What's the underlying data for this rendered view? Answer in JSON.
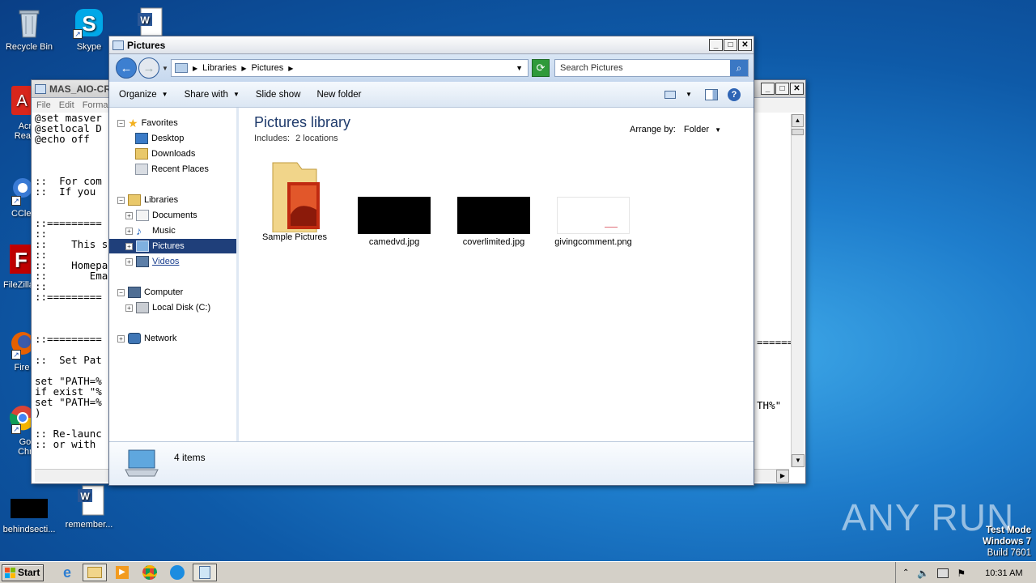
{
  "desktop": {
    "icons": [
      {
        "label": "Recycle Bin"
      },
      {
        "label": "Skype"
      },
      {
        "label": "Acro Reade"
      },
      {
        "label": "CClea"
      },
      {
        "label": "FileZilla"
      },
      {
        "label": "Fire"
      },
      {
        "label": "Goo Chro"
      },
      {
        "label": "behindsecti..."
      },
      {
        "label": "remember..."
      }
    ]
  },
  "notepad": {
    "title": "MAS_AIO-CR",
    "menu": [
      "File",
      "Edit",
      "Forma"
    ],
    "lines": "@set masver\n@setlocal D\n@echo off\n\n\n\n::  For com\n::  If you\n\n\n::=========\n::\n::    This s\n::\n::    Homepa\n::       Ema\n::\n::=========\n\n\n\n::=========\n\n::  Set Pat\n\nset \"PATH=%\nif exist \"%\nset \"PATH=%\n)\n\n:: Re-launc\n:: or with",
    "right_fragment_1": "======",
    "right_fragment_2": "TH%\""
  },
  "explorer": {
    "title": "Pictures",
    "breadcrumb": [
      "Libraries",
      "Pictures"
    ],
    "search_placeholder": "Search Pictures",
    "toolbar": {
      "organize": "Organize",
      "share_with": "Share with",
      "slide_show": "Slide show",
      "new_folder": "New folder"
    },
    "nav": {
      "favorites": "Favorites",
      "desktop": "Desktop",
      "downloads": "Downloads",
      "recent_places": "Recent Places",
      "libraries": "Libraries",
      "documents": "Documents",
      "music": "Music",
      "pictures": "Pictures",
      "videos": "Videos",
      "computer": "Computer",
      "local_disk": "Local Disk (C:)",
      "network": "Network"
    },
    "library_title": "Pictures library",
    "includes_label": "Includes:",
    "includes_link": "2 locations",
    "arrange_label": "Arrange by:",
    "arrange_value": "Folder",
    "files": [
      {
        "name": "Sample Pictures",
        "kind": "folder"
      },
      {
        "name": "camedvd.jpg",
        "kind": "black-image"
      },
      {
        "name": "coverlimited.jpg",
        "kind": "black-image"
      },
      {
        "name": "givingcomment.png",
        "kind": "white-image"
      }
    ],
    "status_count": "4 items"
  },
  "taskbar": {
    "start_label": "Start",
    "time": "10:31 AM"
  },
  "watermark": "ANY RUN",
  "os_notice": {
    "line1": "Test Mode",
    "line2": "Windows 7",
    "line3": "Build 7601"
  },
  "colors": {
    "selection": "#1f3f7a",
    "desktop_blue": "#1e7dcc"
  }
}
